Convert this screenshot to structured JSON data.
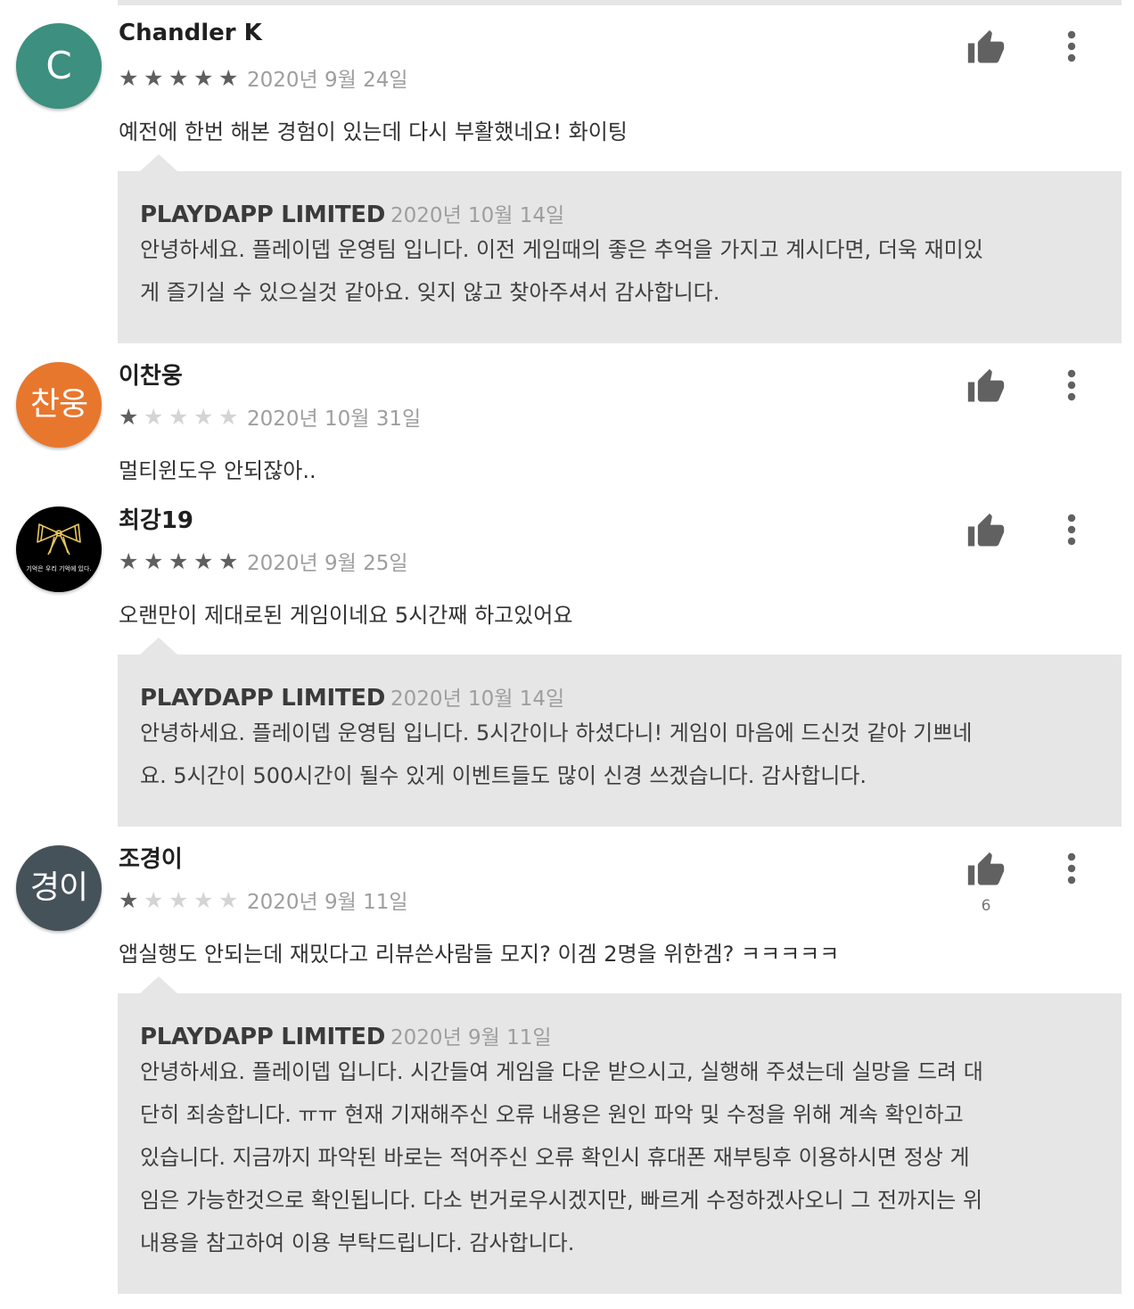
{
  "reviews": [
    {
      "avatar_text": "C",
      "avatar_color": "#3d8f7f",
      "author": "Chandler K",
      "stars": 5,
      "date": "2020년 9월 24일",
      "text": "예전에 한번 해본 경험이 있는데 다시 부활했네요! 화이팅",
      "like_count": "",
      "reply": {
        "developer": "PLAYDAPP LIMITED",
        "date": "2020년 10월 14일",
        "lines": [
          "안녕하세요. 플레이뎁 운영팀 입니다. 이전 게임때의 좋은 추억을 가지고 계시다면, 더욱 재미있",
          "게 즐기실 수 있으실것 같아요. 잊지 않고 찾아주셔서 감사합니다."
        ]
      }
    },
    {
      "avatar_text": "찬웅",
      "avatar_color": "#e8772e",
      "author": "이찬웅",
      "stars": 1,
      "date": "2020년 10월 31일",
      "text": "멀티윈도우 안되잖아..",
      "like_count": ""
    },
    {
      "avatar_text": "",
      "avatar_image_text": "기억은 우리 기억에 있다.",
      "avatar_color": "#000000",
      "bow_color": "#e8c65a",
      "author": "최강19",
      "stars": 5,
      "date": "2020년 9월 25일",
      "text": "오랜만이 제대로된 게임이네요 5시간째 하고있어요",
      "like_count": "",
      "reply": {
        "developer": "PLAYDAPP LIMITED",
        "date": "2020년 10월 14일",
        "lines": [
          "안녕하세요. 플레이뎁 운영팀 입니다. 5시간이나 하셨다니! 게임이 마음에 드신것 같아 기쁘네",
          "요. 5시간이 500시간이 될수 있게 이벤트들도 많이 신경 쓰겠습니다. 감사합니다."
        ]
      }
    },
    {
      "avatar_text": "경이",
      "avatar_color": "#46525a",
      "author": "조경이",
      "stars": 1,
      "date": "2020년 9월 11일",
      "text": "앱실행도 안되는데 재밌다고 리뷰쓴사람들 모지? 이겜 2명을 위한겜? ㅋㅋㅋㅋㅋ",
      "like_count": "6",
      "reply": {
        "developer": "PLAYDAPP LIMITED",
        "date": "2020년 9월 11일",
        "lines": [
          "안녕하세요. 플레이뎁 입니다. 시간들여 게임을 다운 받으시고, 실행해 주셨는데 실망을 드려 대",
          "단히 죄송합니다. ㅠㅠ 현재 기재해주신 오류 내용은 원인 파악 및 수정을 위해 계속 확인하고",
          "있습니다. 지금까지 파악된 바로는 적어주신 오류 확인시 휴대폰 재부팅후 이용하시면 정상 게",
          "임은 가능한것으로 확인됩니다. 다소 번거로우시겠지만, 빠르게 수정하겠사오니 그 전까지는 위",
          "내용을 참고하여 이용 부탁드립니다. 감사합니다."
        ]
      }
    }
  ],
  "icons": {
    "like": "thumbs-up-icon",
    "more": "more-vert-icon",
    "star": "star-icon"
  },
  "colors": {
    "star_on": "#5f5f5f",
    "star_off": "#d4d4d4",
    "reply_bg": "#e6e6e6",
    "icon": "#616161"
  }
}
